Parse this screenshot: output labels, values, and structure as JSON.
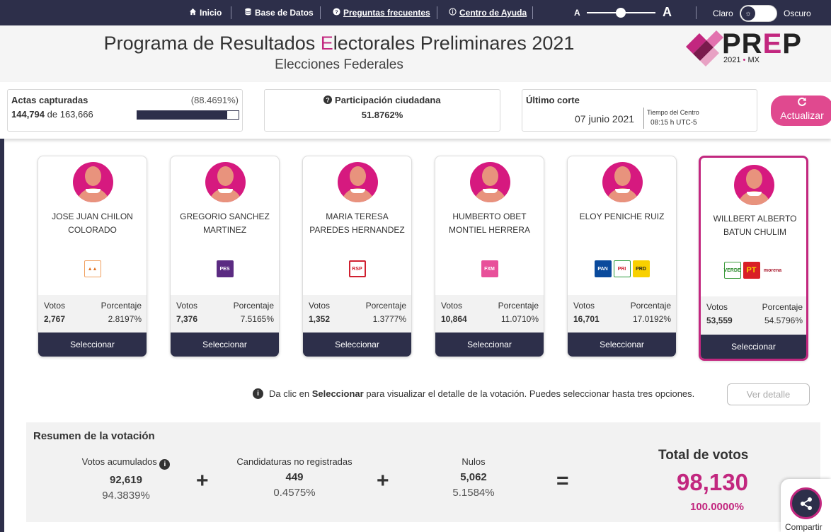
{
  "nav": {
    "inicio": "Inicio",
    "base_datos": "Base de Datos",
    "preguntas": "Preguntas frecuentes",
    "ayuda": "Centro de Ayuda",
    "font_small": "A",
    "font_big": "A",
    "claro": "Claro",
    "oscuro": "Oscuro"
  },
  "header": {
    "title_pre": "Programa de Resultados ",
    "title_e": "E",
    "title_post": "lectorales Preliminares 2021",
    "subtitle": "Elecciones Federales",
    "logo_pr": "PR",
    "logo_e": "E",
    "logo_p": "P",
    "logo_year": "2021",
    "logo_dot": "•",
    "logo_mx": "MX"
  },
  "stats": {
    "actas_title": "Actas capturadas",
    "actas_pct": "(88.4691%)",
    "actas_captured": "144,794",
    "actas_de": "de",
    "actas_total": "163,666",
    "actas_progress": 0.884691,
    "participacion_title": "Participación ciudadana",
    "participacion_value": "51.8762%",
    "corte_title": "Último corte",
    "corte_date": "07 junio 2021",
    "corte_tz": "Tiempo del Centro",
    "corte_time": "08:15 h UTC-5",
    "actualizar": "Actualizar"
  },
  "candidates": [
    {
      "name": "JOSE JUAN CHILON COLORADO",
      "party": [
        "PFM"
      ],
      "votos_label": "Votos",
      "pct_label": "Porcentaje",
      "votos": "2,767",
      "pct": "2.8197%",
      "button": "Seleccionar"
    },
    {
      "name": "GREGORIO SANCHEZ MARTINEZ",
      "party": [
        "PES"
      ],
      "votos_label": "Votos",
      "pct_label": "Porcentaje",
      "votos": "7,376",
      "pct": "7.5165%",
      "button": "Seleccionar"
    },
    {
      "name": "MARIA TERESA PAREDES HERNANDEZ",
      "party": [
        "RSP"
      ],
      "votos_label": "Votos",
      "pct_label": "Porcentaje",
      "votos": "1,352",
      "pct": "1.3777%",
      "button": "Seleccionar"
    },
    {
      "name": "HUMBERTO OBET MONTIEL HERRERA",
      "party": [
        "FXM"
      ],
      "votos_label": "Votos",
      "pct_label": "Porcentaje",
      "votos": "10,864",
      "pct": "11.0710%",
      "button": "Seleccionar"
    },
    {
      "name": "ELOY PENICHE RUIZ",
      "party": [
        "PAN",
        "PRI",
        "PRD"
      ],
      "votos_label": "Votos",
      "pct_label": "Porcentaje",
      "votos": "16,701",
      "pct": "17.0192%",
      "button": "Seleccionar"
    },
    {
      "name": "WILLBERT ALBERTO BATUN CHULIM",
      "party": [
        "VERDE",
        "PT",
        "morena"
      ],
      "votos_label": "Votos",
      "pct_label": "Porcentaje",
      "votos": "53,559",
      "pct": "54.5796%",
      "button": "Seleccionar"
    }
  ],
  "info": {
    "pre": "Da clic en",
    "bold": "Seleccionar",
    "post": "para visualizar el detalle de la votación. Puedes seleccionar hasta tres opciones.",
    "ver_detalle": "Ver detalle"
  },
  "summary": {
    "title": "Resumen de la votación",
    "acumulados_label": "Votos acumulados",
    "acumulados": "92,619",
    "acumulados_pct": "94.3839%",
    "noreg_label": "Candidaturas no registradas",
    "noreg": "449",
    "noreg_pct": "0.4575%",
    "nulos_label": "Nulos",
    "nulos": "5,062",
    "nulos_pct": "5.1584%",
    "plus": "+",
    "equals": "=",
    "total_label": "Total de votos",
    "total": "98,130",
    "total_pct": "100.0000%"
  },
  "share": {
    "label": "Compartir"
  },
  "colors": {
    "navy": "#2d2f4a",
    "magenta": "#c2277f",
    "pink_button": "#e0498f"
  }
}
